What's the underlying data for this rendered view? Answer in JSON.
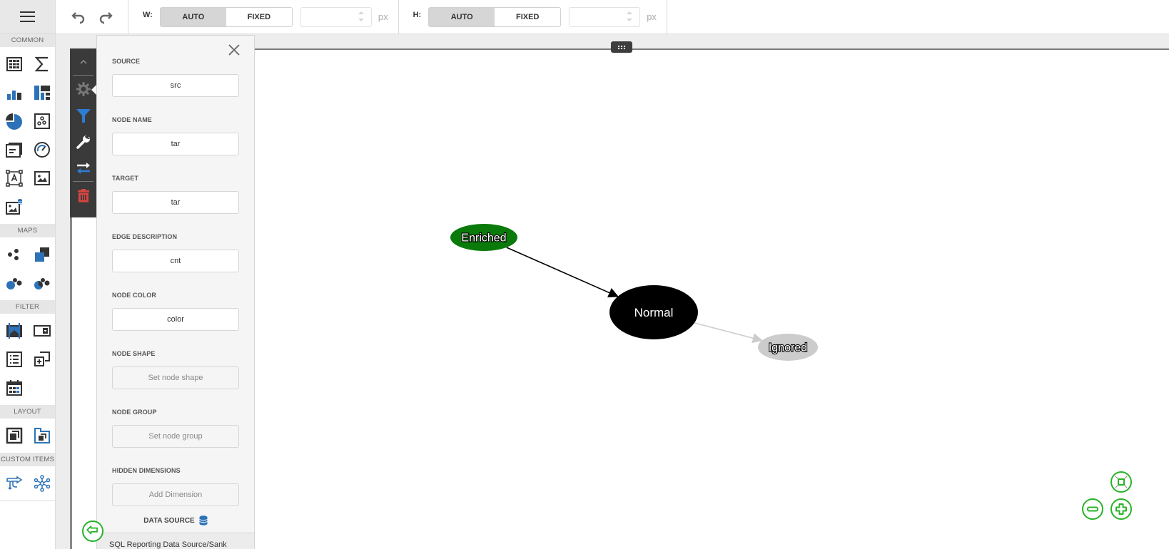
{
  "toolbox": {
    "menu_icon": "hamburger-icon",
    "sections": [
      {
        "title": "COMMON",
        "items": [
          "grid-icon",
          "sum-icon",
          "bar-chart-icon",
          "treemap-icon",
          "pie-chart-icon",
          "scatter-icon",
          "card-icon",
          "gauge-icon",
          "text-box-icon",
          "image-icon",
          "bound-image-icon"
        ]
      },
      {
        "title": "MAPS",
        "items": [
          "geo-point-map-icon",
          "choropleth-map-icon",
          "bubble-map-icon",
          "pie-map-icon"
        ]
      },
      {
        "title": "FILTER",
        "items": [
          "range-filter-icon",
          "combo-box-icon",
          "list-box-icon",
          "tree-view-icon",
          "date-filter-icon"
        ]
      },
      {
        "title": "LAYOUT",
        "items": [
          "group-icon",
          "tab-container-icon"
        ]
      },
      {
        "title": "CUSTOM ITEMS",
        "items": [
          "sankey-icon",
          "network-graph-icon"
        ]
      }
    ]
  },
  "topbar": {
    "undo_icon": "undo-icon",
    "redo_icon": "redo-icon",
    "width": {
      "label": "W:",
      "auto": "AUTO",
      "fixed": "FIXED",
      "selected": "AUTO",
      "value": "",
      "unit": "px"
    },
    "height": {
      "label": "H:",
      "auto": "AUTO",
      "fixed": "FIXED",
      "selected": "AUTO",
      "value": "",
      "unit": "px"
    }
  },
  "item_sidebar": {
    "buttons": [
      "collapse-up-icon",
      "gear-icon",
      "filter-icon",
      "wrench-icon",
      "swap-icon",
      "trash-icon"
    ]
  },
  "binding_panel": {
    "fields": [
      {
        "label": "SOURCE",
        "value": "src",
        "placeholder": false
      },
      {
        "label": "NODE NAME",
        "value": "tar",
        "placeholder": false
      },
      {
        "label": "TARGET",
        "value": "tar",
        "placeholder": false
      },
      {
        "label": "EDGE DESCRIPTION",
        "value": "cnt",
        "placeholder": false
      },
      {
        "label": "NODE COLOR",
        "value": "color",
        "placeholder": false
      },
      {
        "label": "NODE SHAPE",
        "value": "Set node shape",
        "placeholder": true
      },
      {
        "label": "NODE GROUP",
        "value": "Set node group",
        "placeholder": true
      },
      {
        "label": "HIDDEN DIMENSIONS",
        "value": "Add Dimension",
        "placeholder": true
      }
    ],
    "data_source_label": "DATA SOURCE",
    "data_source_name": "SQL Reporting Data Source/Sank"
  },
  "graph": {
    "nodes": [
      {
        "id": "enriched",
        "label": "Enriched",
        "color": "#0a7a0a",
        "text_color": "#ffffff"
      },
      {
        "id": "normal",
        "label": "Normal",
        "color": "#000000",
        "text_color": "#ffffff"
      },
      {
        "id": "ignored",
        "label": "Ignored",
        "color": "#cccccc",
        "text_color": "#ffffff"
      }
    ],
    "edges": [
      {
        "from": "enriched",
        "to": "normal",
        "color": "#000000"
      },
      {
        "from": "normal",
        "to": "ignored",
        "color": "#cccccc"
      }
    ]
  },
  "zoom_controls": {
    "fit": "fit-to-screen-icon",
    "zoom_out": "zoom-out-icon",
    "zoom_in": "zoom-in-icon",
    "back": "back-arrow-icon",
    "accent": "#27b327"
  }
}
